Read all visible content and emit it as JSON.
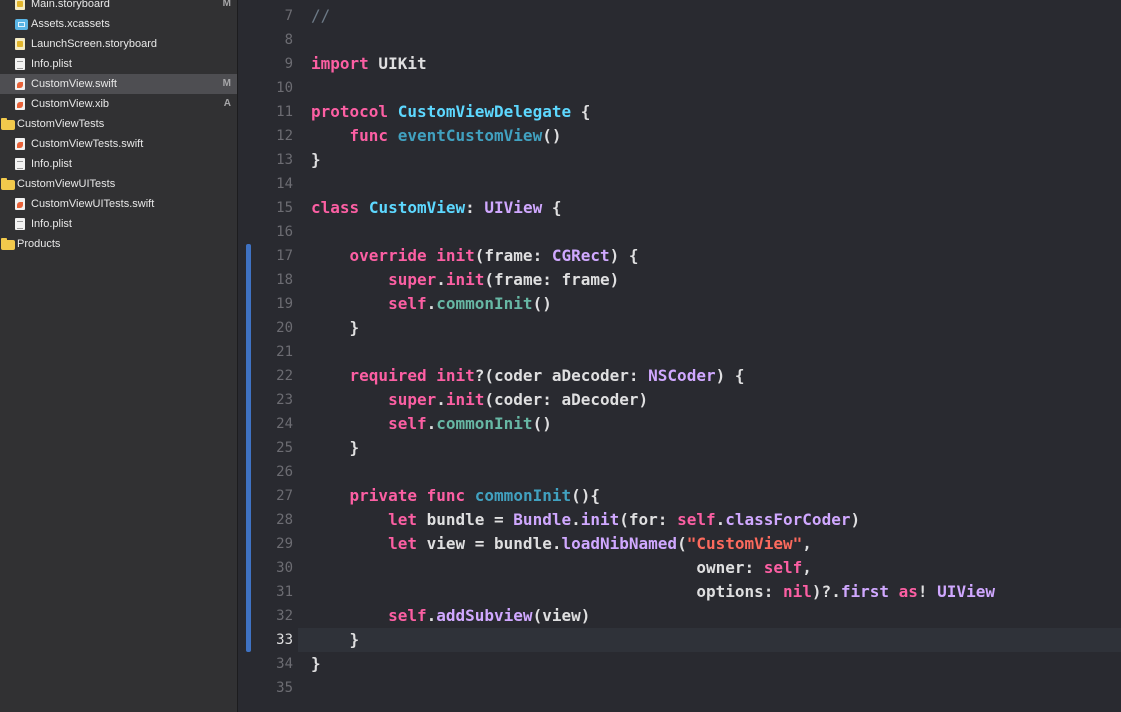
{
  "colors": {
    "editor_bg": "#292a30",
    "navigator_bg": "#313133",
    "keyword": "#fc5fa3",
    "type_declaration": "#5dd8ff",
    "system_type": "#d0a8ff",
    "method_declaration": "#41a1c0",
    "project_method": "#67b7a4",
    "string": "#fc6a5d",
    "comment": "#6c7986",
    "change_bar": "#3f72c2"
  },
  "navigator": {
    "files": [
      {
        "name": "Main.storyboard",
        "icon": "storyboard-icon",
        "badge": "M"
      },
      {
        "name": "Assets.xcassets",
        "icon": "assets-icon",
        "badge": ""
      },
      {
        "name": "LaunchScreen.storyboard",
        "icon": "storyboard-icon",
        "badge": ""
      },
      {
        "name": "Info.plist",
        "icon": "plist-icon",
        "badge": ""
      },
      {
        "name": "CustomView.swift",
        "icon": "swift-file-icon",
        "badge": "M",
        "selected": true
      },
      {
        "name": "CustomView.xib",
        "icon": "xib-icon",
        "badge": "A"
      },
      {
        "name": "CustomViewTests",
        "icon": "folder-icon",
        "badge": ""
      },
      {
        "name": "CustomViewTests.swift",
        "icon": "swift-file-icon",
        "badge": ""
      },
      {
        "name": "Info.plist",
        "icon": "plist-icon",
        "badge": ""
      },
      {
        "name": "CustomViewUITests",
        "icon": "folder-icon",
        "badge": ""
      },
      {
        "name": "CustomViewUITests.swift",
        "icon": "swift-file-icon",
        "badge": ""
      },
      {
        "name": "Info.plist",
        "icon": "plist-icon",
        "badge": ""
      },
      {
        "name": "Products",
        "icon": "folder-icon",
        "badge": ""
      }
    ]
  },
  "editor": {
    "current_line": "33",
    "lines": [
      {
        "num": "7",
        "tokens": [
          [
            "cmt",
            "//"
          ]
        ]
      },
      {
        "num": "8",
        "tokens": []
      },
      {
        "num": "9",
        "tokens": [
          [
            "kw",
            "import"
          ],
          [
            "plain",
            " UIKit"
          ]
        ]
      },
      {
        "num": "10",
        "tokens": []
      },
      {
        "num": "11",
        "tokens": [
          [
            "kw",
            "protocol"
          ],
          [
            "plain",
            " "
          ],
          [
            "tdecl",
            "CustomViewDelegate"
          ],
          [
            "plain",
            " {"
          ]
        ]
      },
      {
        "num": "12",
        "tokens": [
          [
            "plain",
            "    "
          ],
          [
            "kw",
            "func"
          ],
          [
            "plain",
            " "
          ],
          [
            "mdecl",
            "eventCustomView"
          ],
          [
            "plain",
            "()"
          ]
        ]
      },
      {
        "num": "13",
        "tokens": [
          [
            "plain",
            "}"
          ]
        ]
      },
      {
        "num": "14",
        "tokens": []
      },
      {
        "num": "15",
        "tokens": [
          [
            "kw",
            "class"
          ],
          [
            "plain",
            " "
          ],
          [
            "tdecl",
            "CustomView"
          ],
          [
            "plain",
            ": "
          ],
          [
            "tsys",
            "UIView"
          ],
          [
            "plain",
            " {"
          ]
        ]
      },
      {
        "num": "16",
        "tokens": []
      },
      {
        "num": "17",
        "tokens": [
          [
            "plain",
            "    "
          ],
          [
            "kw",
            "override"
          ],
          [
            "plain",
            " "
          ],
          [
            "kw",
            "init"
          ],
          [
            "plain",
            "(frame: "
          ],
          [
            "tsys",
            "CGRect"
          ],
          [
            "plain",
            ") {"
          ]
        ]
      },
      {
        "num": "18",
        "tokens": [
          [
            "plain",
            "        "
          ],
          [
            "kw",
            "super"
          ],
          [
            "plain",
            "."
          ],
          [
            "kw",
            "init"
          ],
          [
            "plain",
            "(frame: frame)"
          ]
        ]
      },
      {
        "num": "19",
        "tokens": [
          [
            "plain",
            "        "
          ],
          [
            "kw",
            "self"
          ],
          [
            "plain",
            "."
          ],
          [
            "mproj",
            "commonInit"
          ],
          [
            "plain",
            "()"
          ]
        ]
      },
      {
        "num": "20",
        "tokens": [
          [
            "plain",
            "    }"
          ]
        ]
      },
      {
        "num": "21",
        "tokens": []
      },
      {
        "num": "22",
        "tokens": [
          [
            "plain",
            "    "
          ],
          [
            "kw",
            "required"
          ],
          [
            "plain",
            " "
          ],
          [
            "kw",
            "init"
          ],
          [
            "plain",
            "?(coder aDecoder: "
          ],
          [
            "tsys",
            "NSCoder"
          ],
          [
            "plain",
            ") {"
          ]
        ]
      },
      {
        "num": "23",
        "tokens": [
          [
            "plain",
            "        "
          ],
          [
            "kw",
            "super"
          ],
          [
            "plain",
            "."
          ],
          [
            "kw",
            "init"
          ],
          [
            "plain",
            "(coder: aDecoder)"
          ]
        ]
      },
      {
        "num": "24",
        "tokens": [
          [
            "plain",
            "        "
          ],
          [
            "kw",
            "self"
          ],
          [
            "plain",
            "."
          ],
          [
            "mproj",
            "commonInit"
          ],
          [
            "plain",
            "()"
          ]
        ]
      },
      {
        "num": "25",
        "tokens": [
          [
            "plain",
            "    }"
          ]
        ]
      },
      {
        "num": "26",
        "tokens": []
      },
      {
        "num": "27",
        "tokens": [
          [
            "plain",
            "    "
          ],
          [
            "kw",
            "private"
          ],
          [
            "plain",
            " "
          ],
          [
            "kw",
            "func"
          ],
          [
            "plain",
            " "
          ],
          [
            "mdecl",
            "commonInit"
          ],
          [
            "plain",
            "(){"
          ]
        ]
      },
      {
        "num": "28",
        "tokens": [
          [
            "plain",
            "        "
          ],
          [
            "kw",
            "let"
          ],
          [
            "plain",
            " bundle = "
          ],
          [
            "tsys",
            "Bundle"
          ],
          [
            "plain",
            "."
          ],
          [
            "tsys",
            "init"
          ],
          [
            "plain",
            "(for: "
          ],
          [
            "kw",
            "self"
          ],
          [
            "plain",
            "."
          ],
          [
            "tsys",
            "classForCoder"
          ],
          [
            "plain",
            ")"
          ]
        ]
      },
      {
        "num": "29",
        "tokens": [
          [
            "plain",
            "        "
          ],
          [
            "kw",
            "let"
          ],
          [
            "plain",
            " view = bundle."
          ],
          [
            "tsys",
            "loadNibNamed"
          ],
          [
            "plain",
            "("
          ],
          [
            "str",
            "\"CustomView\""
          ],
          [
            "plain",
            ","
          ]
        ]
      },
      {
        "num": "30",
        "tokens": [
          [
            "plain",
            "                                        owner: "
          ],
          [
            "kw",
            "self"
          ],
          [
            "plain",
            ","
          ]
        ]
      },
      {
        "num": "31",
        "tokens": [
          [
            "plain",
            "                                        options: "
          ],
          [
            "kw",
            "nil"
          ],
          [
            "plain",
            ")?."
          ],
          [
            "tsys",
            "first"
          ],
          [
            "plain",
            " "
          ],
          [
            "kw",
            "as"
          ],
          [
            "plain",
            "! "
          ],
          [
            "tsys",
            "UIView"
          ]
        ]
      },
      {
        "num": "32",
        "tokens": [
          [
            "plain",
            "        "
          ],
          [
            "kw",
            "self"
          ],
          [
            "plain",
            "."
          ],
          [
            "tsys",
            "addSubview"
          ],
          [
            "plain",
            "(view)"
          ]
        ]
      },
      {
        "num": "33",
        "tokens": [
          [
            "plain",
            "    }"
          ]
        ]
      },
      {
        "num": "34",
        "tokens": [
          [
            "plain",
            "}"
          ]
        ]
      },
      {
        "num": "35",
        "tokens": []
      }
    ]
  }
}
